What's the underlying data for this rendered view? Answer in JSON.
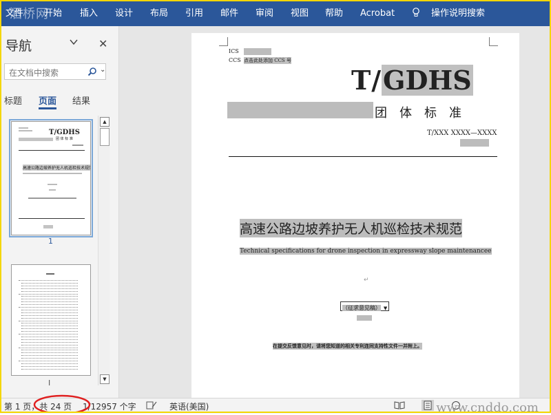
{
  "ribbon": {
    "watermark": "酒桥网",
    "tabs": [
      "文件",
      "开始",
      "插入",
      "设计",
      "布局",
      "引用",
      "邮件",
      "审阅",
      "视图",
      "帮助",
      "Acrobat"
    ],
    "tell_me": "操作说明搜索"
  },
  "nav": {
    "title": "导航",
    "search_placeholder": "在文档中搜索",
    "tabs": [
      "标题",
      "页面",
      "结果"
    ],
    "page1_number": "1",
    "page2_number": "I",
    "thumb1": {
      "org": "T/GDHS",
      "std": "团 体 标 准",
      "title": "高速公路边坡养护无人机巡检技术规范"
    }
  },
  "document": {
    "ics_label": "ICS",
    "ccs_label": "CCS",
    "ccs_hint": "点击此处添加 CCS 号",
    "org_prefix": "T/",
    "org_code": "GDHS",
    "std_type": "团　体　标　准",
    "std_number": "T/XXX XXXX—XXXX",
    "title_cn": "高速公路边坡养护无人机巡检技术规范",
    "title_en": "Technical specifications for drone inspection in expressway slope maintenancee",
    "draft_label": "（征求意见稿）",
    "notice": "在提交反馈意见时，请将您知道的相关专利连同支持性文件一并附上。"
  },
  "status": {
    "page_info": "第 1 页，共 24 页",
    "word_count": "1/12957 个字",
    "language": "英语(美国)",
    "watermark": "www.cnddo.com"
  },
  "colors": {
    "ribbon": "#2b579a",
    "frame": "#f4d600",
    "circle": "#e02020"
  }
}
